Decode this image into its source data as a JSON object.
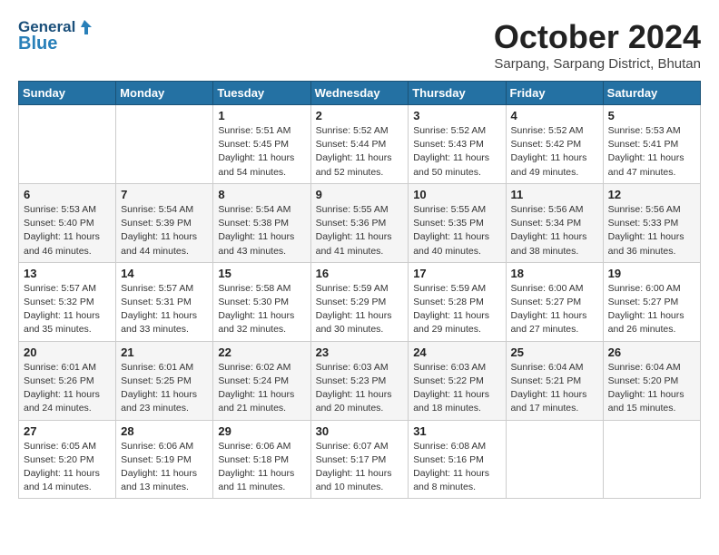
{
  "logo": {
    "line1": "General",
    "line2": "Blue"
  },
  "title": "October 2024",
  "subtitle": "Sarpang, Sarpang District, Bhutan",
  "weekdays": [
    "Sunday",
    "Monday",
    "Tuesday",
    "Wednesday",
    "Thursday",
    "Friday",
    "Saturday"
  ],
  "weeks": [
    [
      {
        "day": "",
        "info": ""
      },
      {
        "day": "",
        "info": ""
      },
      {
        "day": "1",
        "info": "Sunrise: 5:51 AM\nSunset: 5:45 PM\nDaylight: 11 hours and 54 minutes."
      },
      {
        "day": "2",
        "info": "Sunrise: 5:52 AM\nSunset: 5:44 PM\nDaylight: 11 hours and 52 minutes."
      },
      {
        "day": "3",
        "info": "Sunrise: 5:52 AM\nSunset: 5:43 PM\nDaylight: 11 hours and 50 minutes."
      },
      {
        "day": "4",
        "info": "Sunrise: 5:52 AM\nSunset: 5:42 PM\nDaylight: 11 hours and 49 minutes."
      },
      {
        "day": "5",
        "info": "Sunrise: 5:53 AM\nSunset: 5:41 PM\nDaylight: 11 hours and 47 minutes."
      }
    ],
    [
      {
        "day": "6",
        "info": "Sunrise: 5:53 AM\nSunset: 5:40 PM\nDaylight: 11 hours and 46 minutes."
      },
      {
        "day": "7",
        "info": "Sunrise: 5:54 AM\nSunset: 5:39 PM\nDaylight: 11 hours and 44 minutes."
      },
      {
        "day": "8",
        "info": "Sunrise: 5:54 AM\nSunset: 5:38 PM\nDaylight: 11 hours and 43 minutes."
      },
      {
        "day": "9",
        "info": "Sunrise: 5:55 AM\nSunset: 5:36 PM\nDaylight: 11 hours and 41 minutes."
      },
      {
        "day": "10",
        "info": "Sunrise: 5:55 AM\nSunset: 5:35 PM\nDaylight: 11 hours and 40 minutes."
      },
      {
        "day": "11",
        "info": "Sunrise: 5:56 AM\nSunset: 5:34 PM\nDaylight: 11 hours and 38 minutes."
      },
      {
        "day": "12",
        "info": "Sunrise: 5:56 AM\nSunset: 5:33 PM\nDaylight: 11 hours and 36 minutes."
      }
    ],
    [
      {
        "day": "13",
        "info": "Sunrise: 5:57 AM\nSunset: 5:32 PM\nDaylight: 11 hours and 35 minutes."
      },
      {
        "day": "14",
        "info": "Sunrise: 5:57 AM\nSunset: 5:31 PM\nDaylight: 11 hours and 33 minutes."
      },
      {
        "day": "15",
        "info": "Sunrise: 5:58 AM\nSunset: 5:30 PM\nDaylight: 11 hours and 32 minutes."
      },
      {
        "day": "16",
        "info": "Sunrise: 5:59 AM\nSunset: 5:29 PM\nDaylight: 11 hours and 30 minutes."
      },
      {
        "day": "17",
        "info": "Sunrise: 5:59 AM\nSunset: 5:28 PM\nDaylight: 11 hours and 29 minutes."
      },
      {
        "day": "18",
        "info": "Sunrise: 6:00 AM\nSunset: 5:27 PM\nDaylight: 11 hours and 27 minutes."
      },
      {
        "day": "19",
        "info": "Sunrise: 6:00 AM\nSunset: 5:27 PM\nDaylight: 11 hours and 26 minutes."
      }
    ],
    [
      {
        "day": "20",
        "info": "Sunrise: 6:01 AM\nSunset: 5:26 PM\nDaylight: 11 hours and 24 minutes."
      },
      {
        "day": "21",
        "info": "Sunrise: 6:01 AM\nSunset: 5:25 PM\nDaylight: 11 hours and 23 minutes."
      },
      {
        "day": "22",
        "info": "Sunrise: 6:02 AM\nSunset: 5:24 PM\nDaylight: 11 hours and 21 minutes."
      },
      {
        "day": "23",
        "info": "Sunrise: 6:03 AM\nSunset: 5:23 PM\nDaylight: 11 hours and 20 minutes."
      },
      {
        "day": "24",
        "info": "Sunrise: 6:03 AM\nSunset: 5:22 PM\nDaylight: 11 hours and 18 minutes."
      },
      {
        "day": "25",
        "info": "Sunrise: 6:04 AM\nSunset: 5:21 PM\nDaylight: 11 hours and 17 minutes."
      },
      {
        "day": "26",
        "info": "Sunrise: 6:04 AM\nSunset: 5:20 PM\nDaylight: 11 hours and 15 minutes."
      }
    ],
    [
      {
        "day": "27",
        "info": "Sunrise: 6:05 AM\nSunset: 5:20 PM\nDaylight: 11 hours and 14 minutes."
      },
      {
        "day": "28",
        "info": "Sunrise: 6:06 AM\nSunset: 5:19 PM\nDaylight: 11 hours and 13 minutes."
      },
      {
        "day": "29",
        "info": "Sunrise: 6:06 AM\nSunset: 5:18 PM\nDaylight: 11 hours and 11 minutes."
      },
      {
        "day": "30",
        "info": "Sunrise: 6:07 AM\nSunset: 5:17 PM\nDaylight: 11 hours and 10 minutes."
      },
      {
        "day": "31",
        "info": "Sunrise: 6:08 AM\nSunset: 5:16 PM\nDaylight: 11 hours and 8 minutes."
      },
      {
        "day": "",
        "info": ""
      },
      {
        "day": "",
        "info": ""
      }
    ]
  ]
}
